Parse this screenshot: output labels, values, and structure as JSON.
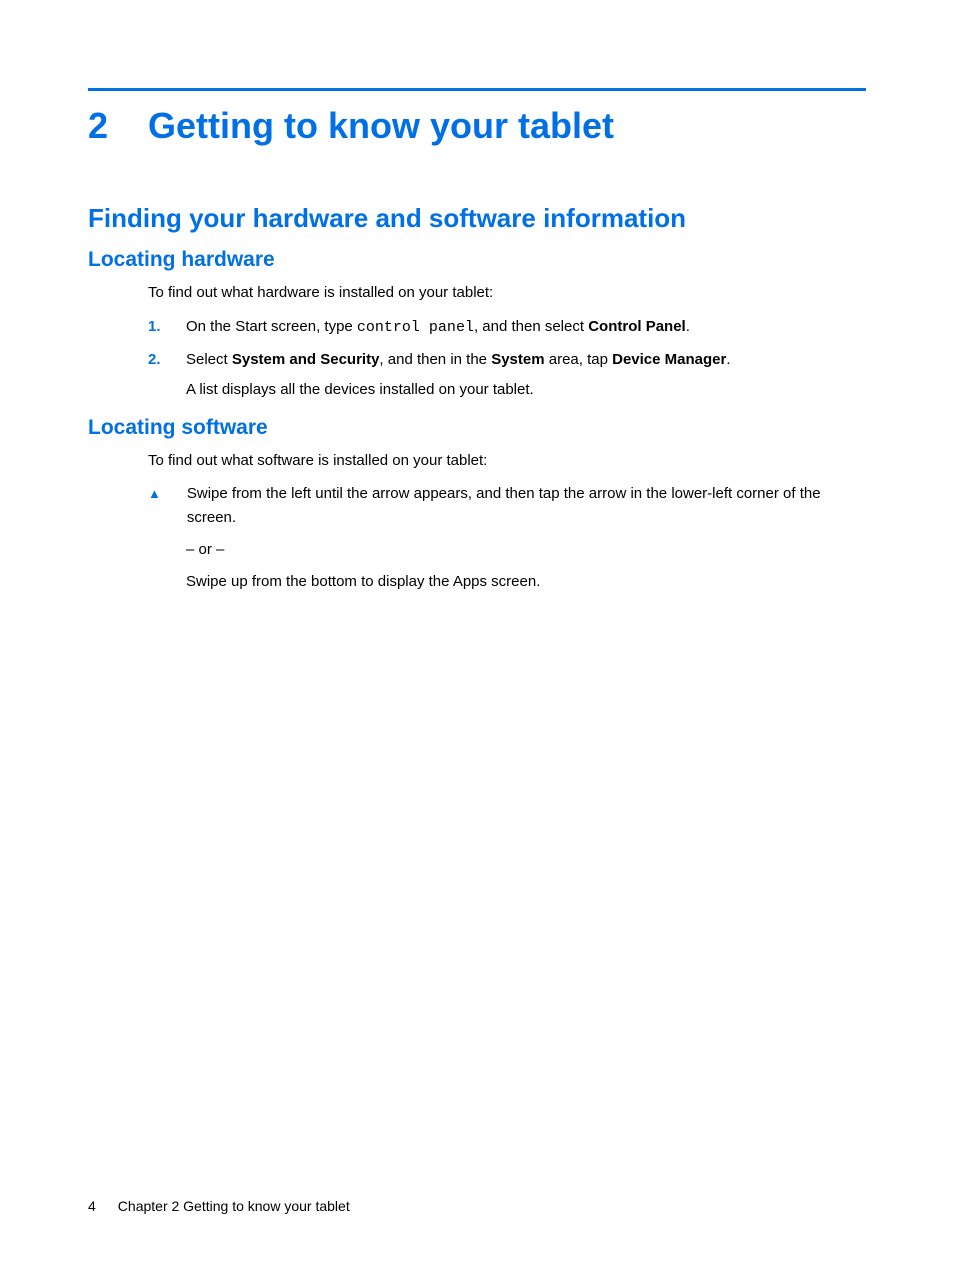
{
  "chapter": {
    "number": "2",
    "title": "Getting to know your tablet"
  },
  "section1": {
    "title": "Finding your hardware and software information"
  },
  "sub_hardware": {
    "title": "Locating hardware",
    "intro": "To find out what hardware is installed on your tablet:",
    "step1": {
      "num": "1.",
      "prefix": "On the Start screen, type ",
      "code": "control panel",
      "mid": ", and then select ",
      "bold": "Control Panel",
      "suffix": "."
    },
    "step2": {
      "num": "2.",
      "prefix": "Select ",
      "bold1": "System and Security",
      "mid1": ", and then in the ",
      "bold2": "System",
      "mid2": " area, tap ",
      "bold3": "Device Manager",
      "suffix": ".",
      "followup": "A list displays all the devices installed on your tablet."
    }
  },
  "sub_software": {
    "title": "Locating software",
    "intro": "To find out what software is installed on your tablet:",
    "bullet1": "Swipe from the left until the arrow appears, and then tap the arrow in the lower-left corner of the screen.",
    "or": "– or –",
    "alt": "Swipe up from the bottom to display the Apps screen."
  },
  "footer": {
    "page": "4",
    "chapter_label": "Chapter 2   Getting to know your tablet"
  }
}
